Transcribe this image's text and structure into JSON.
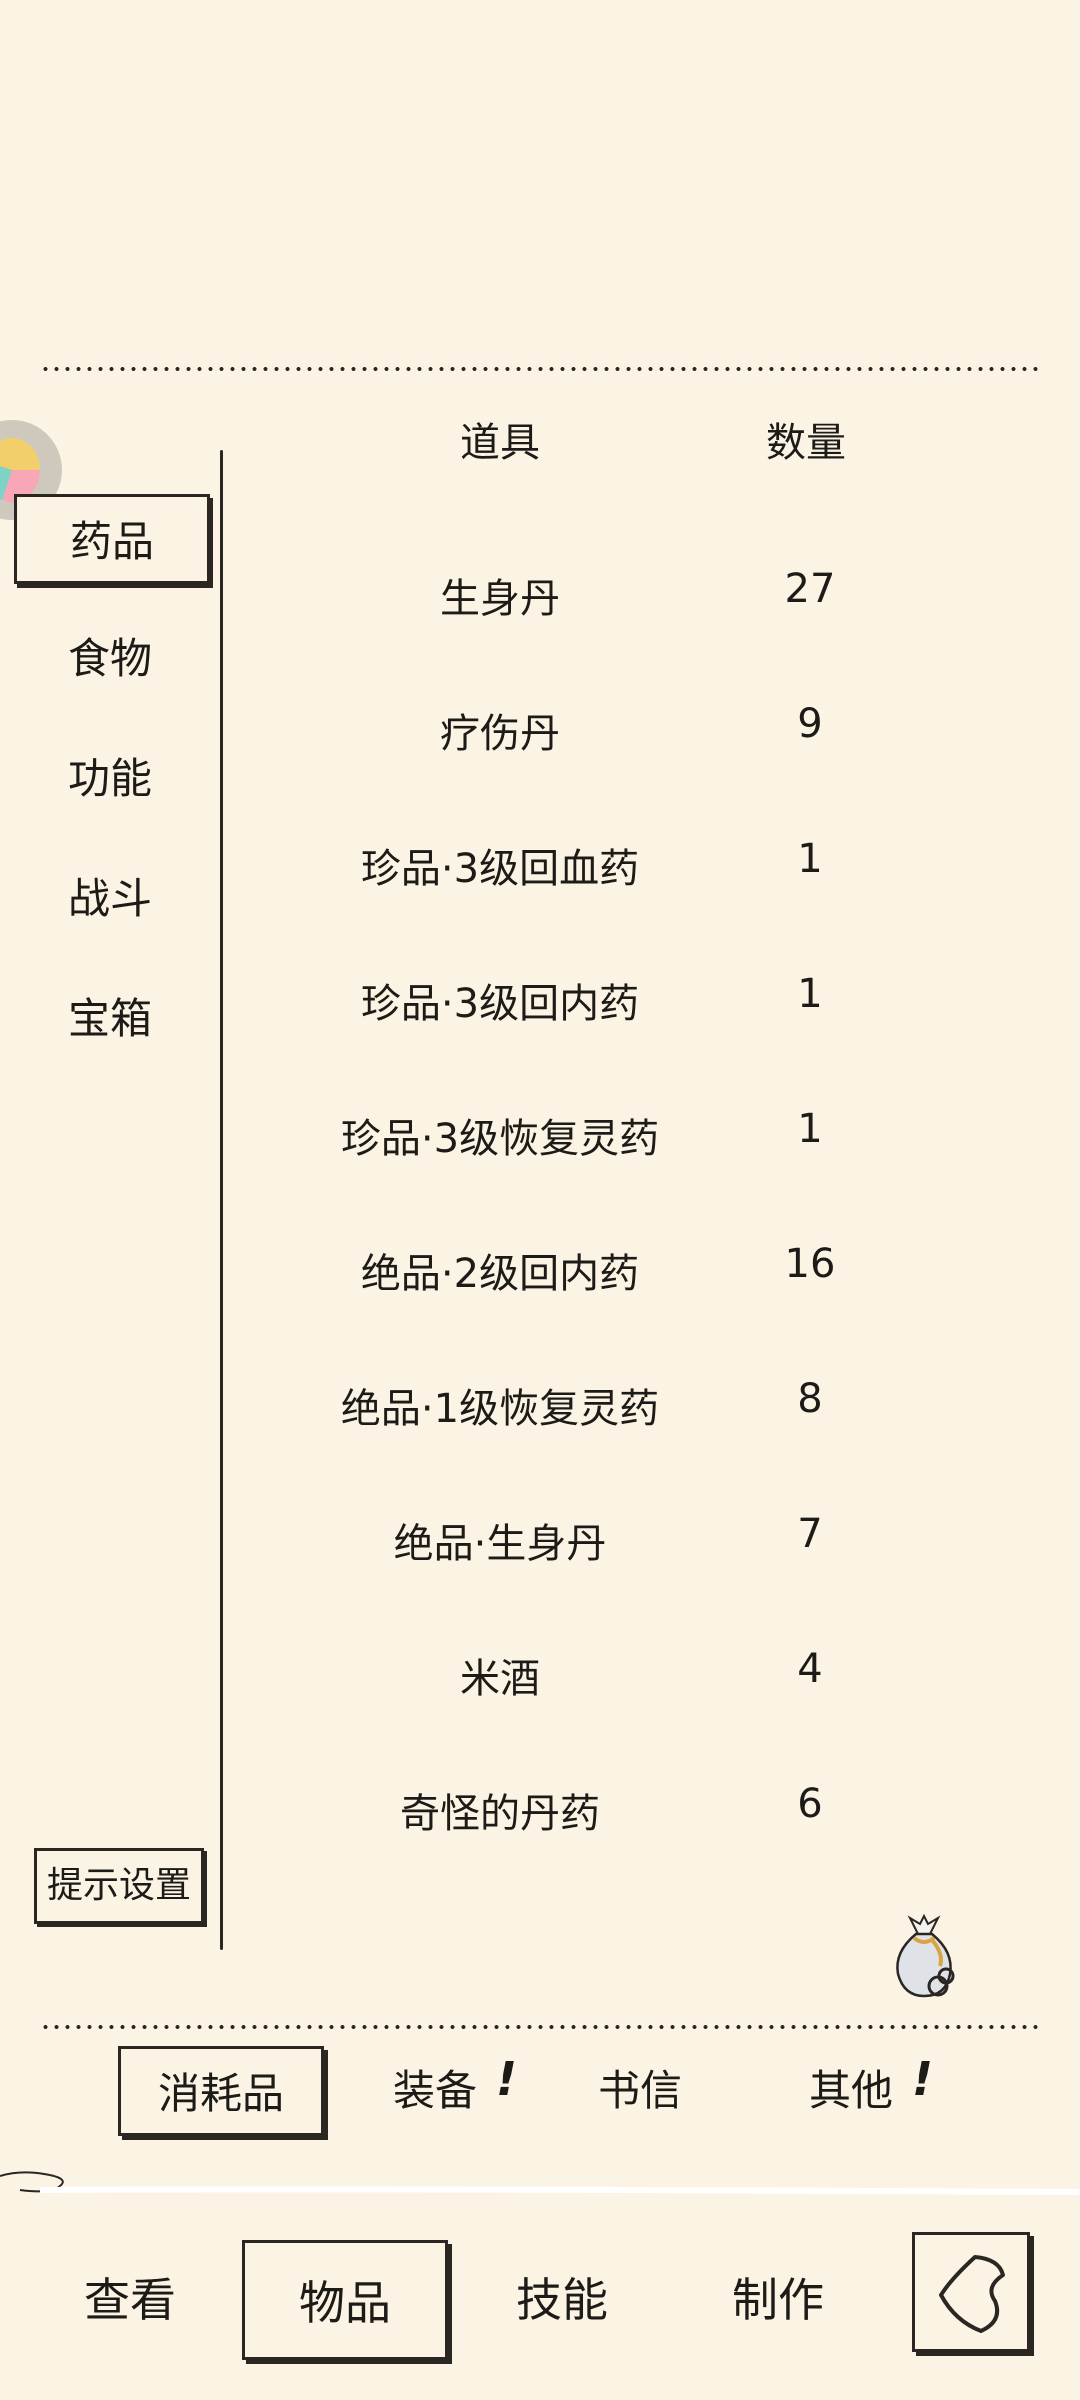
{
  "categories": [
    {
      "label": "药品",
      "active": true
    },
    {
      "label": "食物",
      "active": false
    },
    {
      "label": "功能",
      "active": false
    },
    {
      "label": "战斗",
      "active": false
    },
    {
      "label": "宝箱",
      "active": false
    }
  ],
  "hint_settings_label": "提示设置",
  "table": {
    "headers": {
      "item": "道具",
      "quantity": "数量"
    },
    "rows": [
      {
        "name": "生身丹",
        "qty": "27"
      },
      {
        "name": "疗伤丹",
        "qty": "9"
      },
      {
        "name": "珍品·3级回血药",
        "qty": "1"
      },
      {
        "name": "珍品·3级回内药",
        "qty": "1"
      },
      {
        "name": "珍品·3级恢复灵药",
        "qty": "1"
      },
      {
        "name": "绝品·2级回内药",
        "qty": "16"
      },
      {
        "name": "绝品·1级恢复灵药",
        "qty": "8"
      },
      {
        "name": "绝品·生身丹",
        "qty": "7"
      },
      {
        "name": "米酒",
        "qty": "4"
      },
      {
        "name": "奇怪的丹药",
        "qty": "6"
      }
    ]
  },
  "subtabs": [
    {
      "label": "消耗品",
      "active": true,
      "badge": ""
    },
    {
      "label": "装备",
      "active": false,
      "badge": "!"
    },
    {
      "label": "书信",
      "active": false,
      "badge": ""
    },
    {
      "label": "其他",
      "active": false,
      "badge": "!"
    }
  ],
  "nav": [
    {
      "label": "查看",
      "active": false
    },
    {
      "label": "物品",
      "active": true
    },
    {
      "label": "技能",
      "active": false
    },
    {
      "label": "制作",
      "active": false
    }
  ],
  "icons": {
    "avatar": "avatar-icon",
    "bag": "bag-icon",
    "back": "back-icon"
  }
}
